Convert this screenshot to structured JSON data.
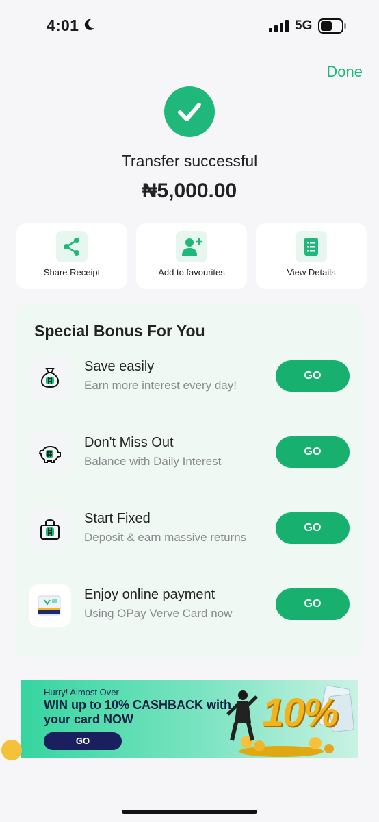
{
  "status_bar": {
    "time": "4:01",
    "network": "5G"
  },
  "header": {
    "done_label": "Done"
  },
  "result": {
    "status_text": "Transfer successful",
    "amount": "₦5,000.00"
  },
  "actions": [
    {
      "label": "Share Receipt",
      "icon": "share-icon"
    },
    {
      "label": "Add to favourites",
      "icon": "add-user-icon"
    },
    {
      "label": "View Details",
      "icon": "list-details-icon"
    }
  ],
  "bonus": {
    "title": "Special Bonus For You",
    "items": [
      {
        "title": "Save easily",
        "subtitle": "Earn more interest every day!",
        "button": "GO",
        "icon": "money-bag-icon"
      },
      {
        "title": "Don't Miss Out",
        "subtitle": "Balance with Daily Interest",
        "button": "GO",
        "icon": "piggy-bank-icon"
      },
      {
        "title": "Start Fixed",
        "subtitle": "Deposit & earn massive returns",
        "button": "GO",
        "icon": "lock-bag-icon"
      },
      {
        "title": "Enjoy online payment",
        "subtitle": "Using OPay Verve Card now",
        "button": "GO",
        "icon": "card-icon"
      }
    ]
  },
  "banner": {
    "kicker": "Hurry! Almost Over",
    "headline": "WIN up to 10% CASHBACK with your card NOW",
    "button": "GO",
    "art_text": "10%"
  },
  "colors": {
    "accent": "#1fb77a",
    "bonus_bg": "#eff8f3",
    "banner_button": "#1a1f5e"
  }
}
